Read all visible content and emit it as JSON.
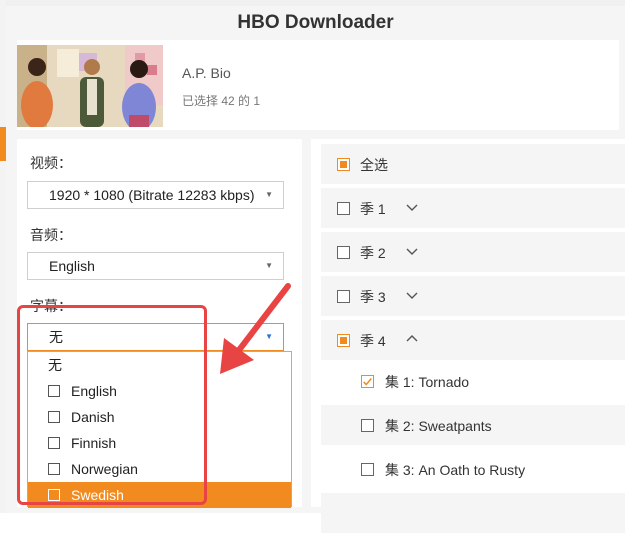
{
  "window": {
    "title": "HBO Downloader"
  },
  "header": {
    "show_title": "A.P. Bio",
    "selection_status": "已选择 42 的 1"
  },
  "video": {
    "label": "视频：",
    "selected": "1920 * 1080 (Bitrate 12283 kbps)"
  },
  "audio": {
    "label": "音频：",
    "selected": "English"
  },
  "subtitle": {
    "label": "字幕：",
    "selected": "无",
    "options": [
      {
        "label": "无",
        "checkbox": false
      },
      {
        "label": "English",
        "checkbox": true
      },
      {
        "label": "Danish",
        "checkbox": true
      },
      {
        "label": "Finnish",
        "checkbox": true
      },
      {
        "label": "Norwegian",
        "checkbox": true
      },
      {
        "label": "Swedish",
        "checkbox": true,
        "highlighted": true
      }
    ]
  },
  "episodes": {
    "select_all_label": "全选",
    "seasons": [
      {
        "label": "季 1",
        "expanded": false
      },
      {
        "label": "季 2",
        "expanded": false
      },
      {
        "label": "季 3",
        "expanded": false
      },
      {
        "label": "季 4",
        "expanded": true
      }
    ],
    "episode_prefix": "集",
    "items": [
      {
        "label": "1: Tornado",
        "checked": true
      },
      {
        "label": "2: Sweatpants",
        "checked": false
      },
      {
        "label": "3: An Oath to Rusty",
        "checked": false
      }
    ]
  },
  "colors": {
    "accent": "#f28b1f",
    "annotation": "#e94444",
    "panel_bg": "#f5f5f5",
    "caret_active": "#2e6fd8"
  },
  "icons": {
    "season_collapsed": "chevron-down-icon",
    "season_expanded": "chevron-up-icon",
    "dropdown_caret": "caret-down-icon"
  }
}
